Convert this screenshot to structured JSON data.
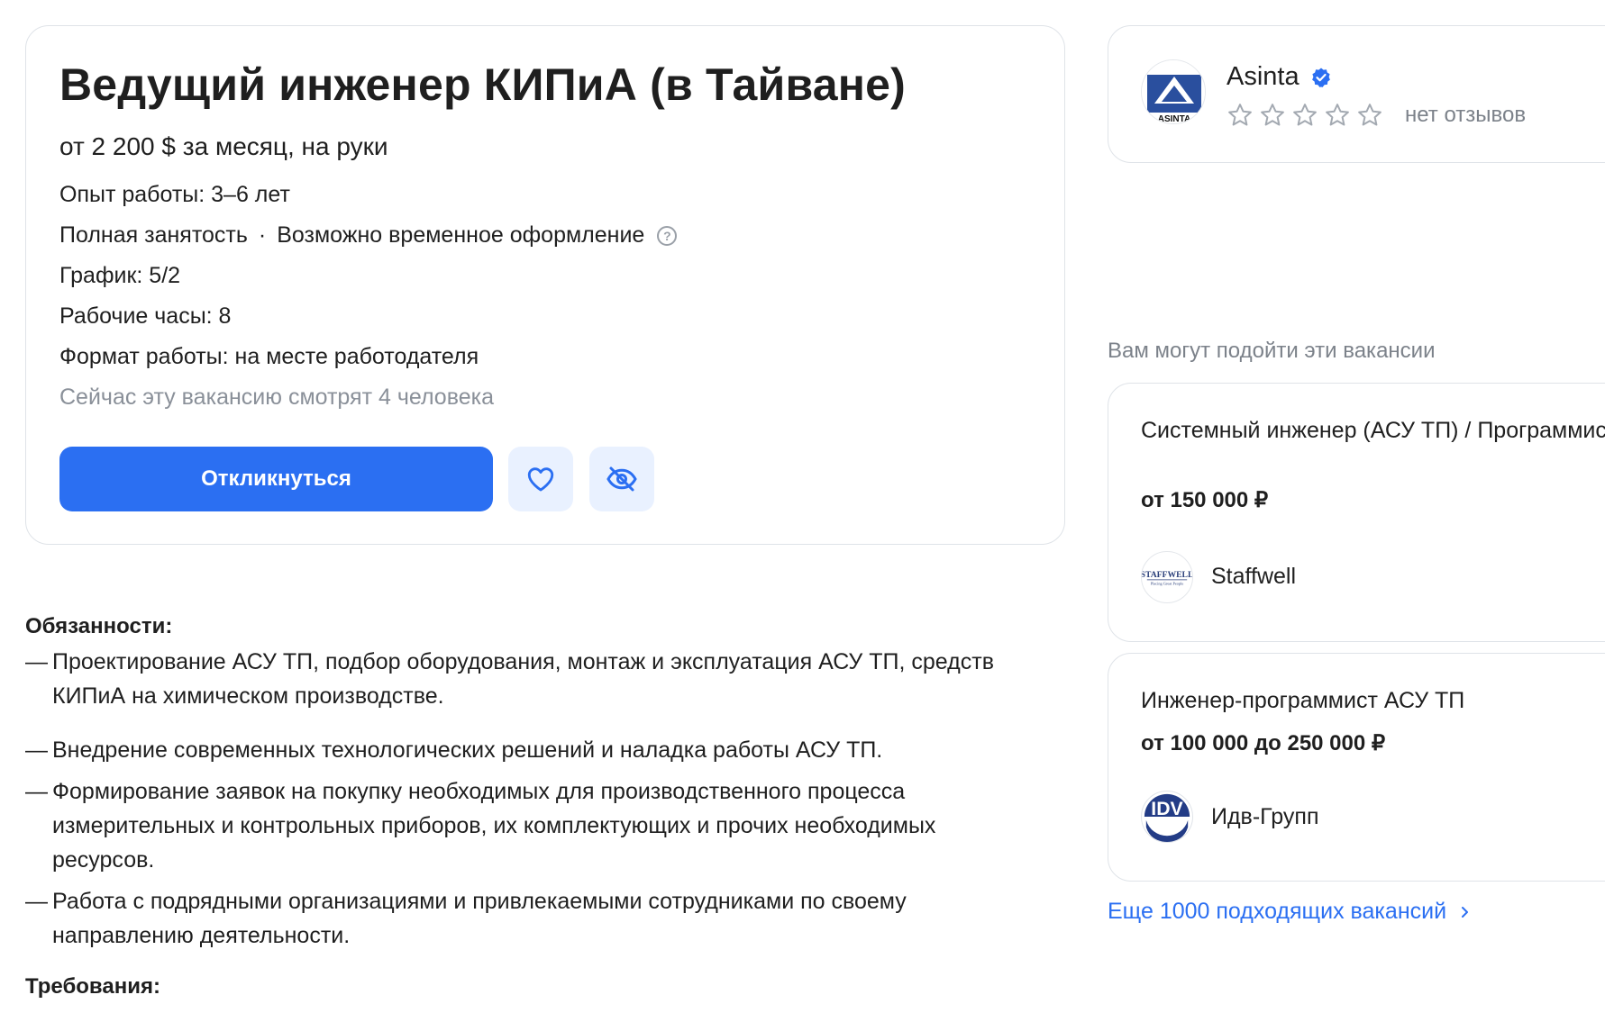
{
  "vacancy": {
    "title": "Ведущий инженер КИПиА (в Тайване)",
    "salary": "от 2 200 $ за месяц, на руки",
    "experience": "Опыт работы: 3–6 лет",
    "employment": "Полная занятость",
    "employment_sep": "·",
    "temporary": "Возможно временное оформление",
    "help_glyph": "?",
    "schedule": "График: 5/2",
    "hours": "Рабочие часы: 8",
    "format": "Формат работы: на месте работодателя",
    "viewers": "Сейчас эту вакансию смотрят 4 человека",
    "apply_label": "Откликнуться",
    "icons": {
      "favorite": "heart-icon",
      "hide": "eye-off-icon"
    },
    "accent_color": "#2b6ff2"
  },
  "description": {
    "duties_title": "Обязанности:",
    "dash": "—",
    "duties": [
      "Проектирование АСУ ТП, подбор оборудования, монтаж и эксплуатация АСУ ТП, средств КИПиА на химическом производстве.",
      "Внедрение современных технологических решений и наладка работы АСУ ТП.",
      "Формирование заявок на покупку необходимых для производственного процесса измерительных и контрольных приборов, их комплектующих и прочих необходимых ресурсов.",
      "Работа с подрядными организациями и привлекаемыми сотрудниками по своему направлению деятельности."
    ],
    "requirements_title": "Требования:"
  },
  "company": {
    "name": "Asinta",
    "logo_text": "ASINTA",
    "verified_icon": "verified-check-icon",
    "rating_stars": 0,
    "rating_max": 5,
    "reviews": "нет отзывов"
  },
  "suggestions": {
    "title": "Вам могут подойти эти вакансии",
    "items": [
      {
        "title": "Системный инженер (АСУ ТП) / Программист АСУТП",
        "salary": "от 150 000 ₽",
        "company": "Staffwell",
        "logo_text": "STAFFWELL",
        "logo_subtext": "Placing Great People"
      },
      {
        "title": "Инженер-программист АСУ ТП",
        "salary": "от 100 000 до 250 000 ₽",
        "company": "Идв-Групп",
        "logo_text": "IDV",
        "logo_subtext": "GROUP"
      }
    ],
    "more_link": "Еще 1000 подходящих вакансий",
    "more_icon": "chevron-right-icon"
  }
}
